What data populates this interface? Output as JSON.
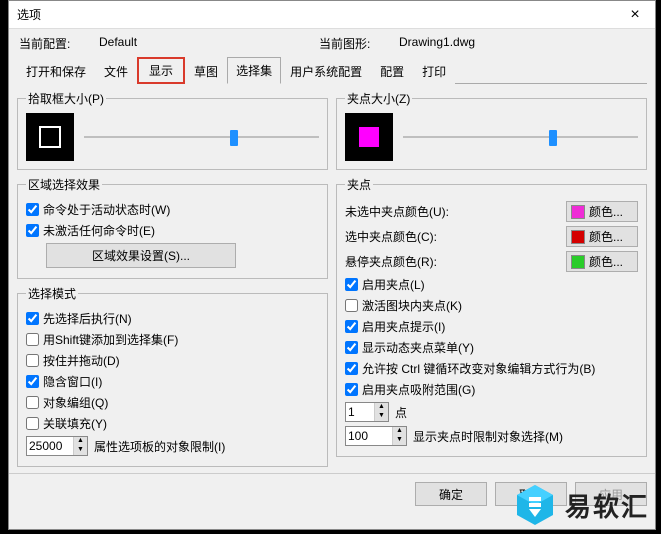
{
  "window": {
    "title": "选项",
    "close_glyph": "×"
  },
  "info": {
    "label_config": "当前配置:",
    "value_config": "Default",
    "label_drawing": "当前图形:",
    "value_drawing": "Drawing1.dwg"
  },
  "tabs": {
    "open_save": "打开和保存",
    "file": "文件",
    "display": "显示",
    "sketch": "草图",
    "selection": "选择集",
    "user_sys": "用户系统配置",
    "config": "配置",
    "print": "打印"
  },
  "left": {
    "pickbox": {
      "legend": "拾取框大小(P)",
      "slider_pos_pct": 62
    },
    "region": {
      "legend": "区域选择效果",
      "cmd_active": "命令处于活动状态时(W)",
      "no_cmd_active": "未激活任何命令时(E)",
      "settings_btn": "区域效果设置(S)..."
    },
    "mode": {
      "legend": "选择模式",
      "pre_exec": "先选择后执行(N)",
      "shift_add": "用Shift键添加到选择集(F)",
      "press_drag": "按住并拖动(D)",
      "implied_win": "隐含窗口(I)",
      "obj_group": "对象编组(Q)",
      "assoc_fill": "关联填充(Y)",
      "limit_value": "25000",
      "limit_label": "属性选项板的对象限制(I)"
    }
  },
  "right": {
    "gripsize": {
      "legend": "夹点大小(Z)",
      "slider_pos_pct": 62
    },
    "grip": {
      "legend": "夹点",
      "unsel_color_lbl": "未选中夹点颜色(U):",
      "sel_color_lbl": "选中夹点颜色(C):",
      "hover_color_lbl": "悬停夹点颜色(R):",
      "color_btn_text": "颜色...",
      "colors": {
        "unsel": "#ef2bd6",
        "sel": "#d40000",
        "hover": "#29cc29"
      },
      "enable_grip": "启用夹点(L)",
      "grip_in_block": "激活图块内夹点(K)",
      "grip_tip": "启用夹点提示(I)",
      "dynamic_menu": "显示动态夹点菜单(Y)",
      "ctrl_cycle": "允许按 Ctrl 键循环改变对象编辑方式行为(B)",
      "snap_range": "启用夹点吸附范围(G)",
      "dot_value": "1",
      "dot_label": "点",
      "limit_value": "100",
      "limit_label": "显示夹点时限制对象选择(M)"
    }
  },
  "footer": {
    "ok": "确定",
    "cancel": "取消",
    "apply": "应用"
  },
  "logo": {
    "text": "易软汇"
  }
}
